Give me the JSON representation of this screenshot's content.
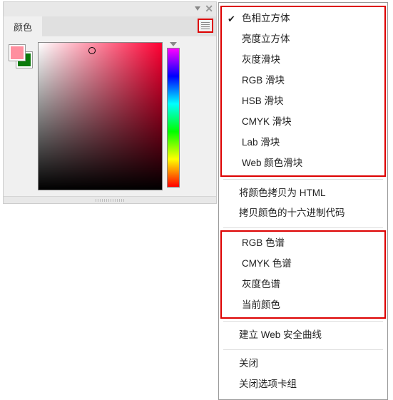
{
  "panel": {
    "title_tab": "颜色",
    "swatch_fg": "#ff8f9f",
    "swatch_bg": "#0b7a0b"
  },
  "menu": {
    "group1": [
      "色相立方体",
      "亮度立方体",
      "灰度滑块",
      "RGB 滑块",
      "HSB 滑块",
      "CMYK 滑块",
      "Lab 滑块",
      "Web 颜色滑块"
    ],
    "group1_checked_index": 0,
    "group2": [
      "将颜色拷贝为 HTML",
      "拷贝颜色的十六进制代码"
    ],
    "group3": [
      "RGB 色谱",
      "CMYK 色谱",
      "灰度色谱",
      "当前颜色"
    ],
    "group4": [
      "建立 Web 安全曲线"
    ],
    "group5": [
      "关闭",
      "关闭选项卡组"
    ]
  }
}
